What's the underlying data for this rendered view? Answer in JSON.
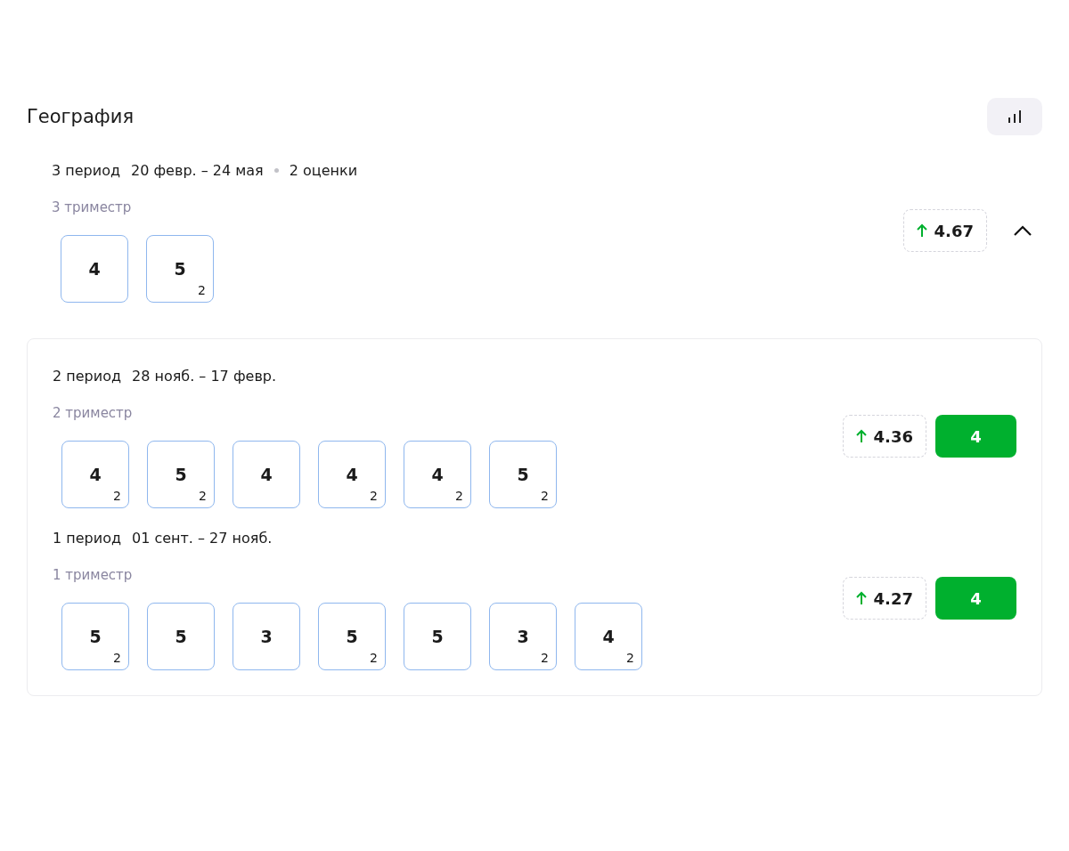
{
  "subject": {
    "title": "География"
  },
  "current_period": {
    "name": "3 период",
    "dates": "20 февр. – 24 мая",
    "count": "2 оценки",
    "term": "3 триместр",
    "average": "4.67",
    "rising": true,
    "expanded": true,
    "marks": [
      {
        "value": "4"
      },
      {
        "value": "5",
        "weight": "2"
      }
    ]
  },
  "past_periods": [
    {
      "name": "2 период",
      "dates": "28 нояб. – 17 февр.",
      "term": "2 триместр",
      "average": "4.36",
      "rising": true,
      "final": "4",
      "marks": [
        {
          "value": "4",
          "weight": "2"
        },
        {
          "value": "5",
          "weight": "2"
        },
        {
          "value": "4"
        },
        {
          "value": "4",
          "weight": "2"
        },
        {
          "value": "4",
          "weight": "2"
        },
        {
          "value": "5",
          "weight": "2"
        }
      ]
    },
    {
      "name": "1 период",
      "dates": "01 сент. – 27 нояб.",
      "term": "1 триместр",
      "average": "4.27",
      "rising": true,
      "final": "4",
      "marks": [
        {
          "value": "5",
          "weight": "2"
        },
        {
          "value": "5"
        },
        {
          "value": "3"
        },
        {
          "value": "5",
          "weight": "2"
        },
        {
          "value": "5"
        },
        {
          "value": "3",
          "weight": "2"
        },
        {
          "value": "4",
          "weight": "2"
        }
      ]
    }
  ]
}
